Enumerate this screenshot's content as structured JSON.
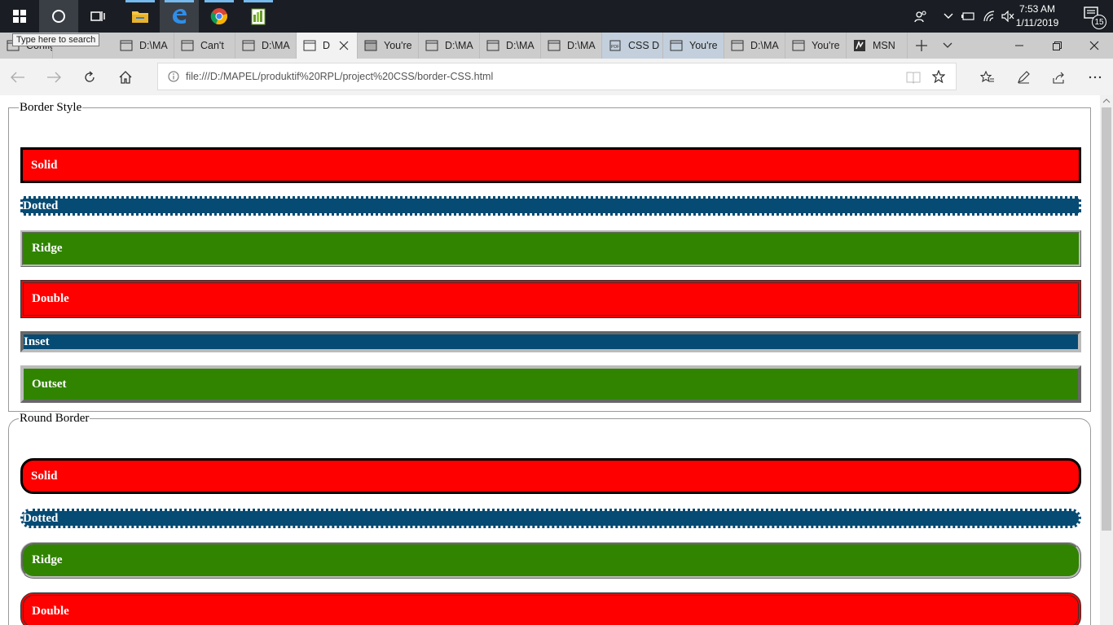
{
  "taskbar": {
    "search_tooltip": "Type here to search",
    "clock_time": "7:53 AM",
    "clock_date": "1/11/2019",
    "notification_count": "15",
    "apps": [
      "start-icon",
      "cortana-icon",
      "task-view-icon",
      "file-explorer-icon",
      "edge-icon",
      "chrome-icon",
      "notepad-plus-plus-icon"
    ]
  },
  "tabs": [
    {
      "label": "Config",
      "icon": "page-icon"
    },
    {
      "label": "D:\\MA",
      "icon": "page-icon"
    },
    {
      "label": "Can't",
      "icon": "page-icon"
    },
    {
      "label": "D:\\MA",
      "icon": "page-icon"
    },
    {
      "label": "D",
      "icon": "page-icon",
      "active": true
    },
    {
      "label": "You're",
      "icon": "page-icon"
    },
    {
      "label": "D:\\MA",
      "icon": "page-icon"
    },
    {
      "label": "D:\\MA",
      "icon": "page-icon"
    },
    {
      "label": "D:\\MA",
      "icon": "page-icon"
    },
    {
      "label": "CSS D",
      "icon": "pdf-icon"
    },
    {
      "label": "You're",
      "icon": "page-icon"
    },
    {
      "label": "D:\\MA",
      "icon": "page-icon"
    },
    {
      "label": "You're",
      "icon": "page-icon"
    },
    {
      "label": "MSN",
      "icon": "msn-icon"
    }
  ],
  "address_bar": {
    "url": "file:///D:/MAPEL/produktif%20RPL/project%20CSS/border-CSS.html"
  },
  "page": {
    "border_style": {
      "legend": "Border Style",
      "items": [
        "Solid",
        "Dotted",
        "Ridge",
        "Double",
        "Inset",
        "Outset"
      ]
    },
    "round_border": {
      "legend": "Round Border",
      "items": [
        "Solid",
        "Dotted",
        "Ridge",
        "Double"
      ]
    }
  },
  "colors": {
    "red": "#ff0000",
    "blue": "#064b73",
    "green": "#308400",
    "taskbar": "#1a1e24",
    "tabbar": "#cccccc"
  }
}
